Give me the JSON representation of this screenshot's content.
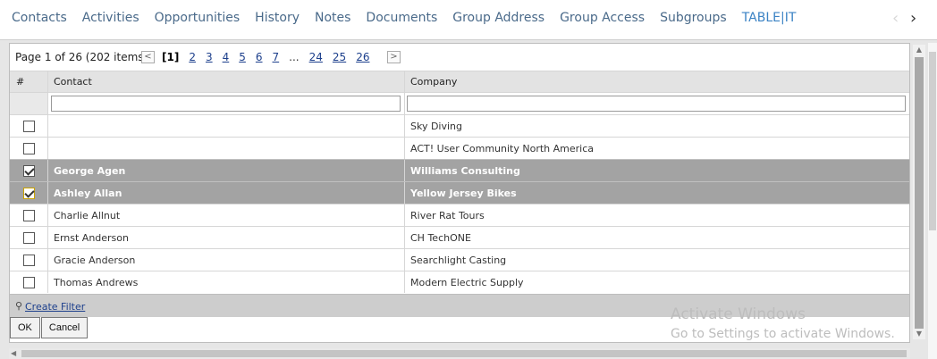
{
  "tabs": [
    {
      "label": "Contacts"
    },
    {
      "label": "Activities"
    },
    {
      "label": "Opportunities"
    },
    {
      "label": "History"
    },
    {
      "label": "Notes"
    },
    {
      "label": "Documents"
    },
    {
      "label": "Group Address"
    },
    {
      "label": "Group Access"
    },
    {
      "label": "Subgroups"
    },
    {
      "label": "TABLE|IT"
    }
  ],
  "tab_nav": {
    "prev": "‹",
    "next": "›"
  },
  "pager": {
    "info": "Page 1 of 26 (202 items)",
    "prev": "<",
    "next": ">",
    "pages": [
      "[1]",
      "2",
      "3",
      "4",
      "5",
      "6",
      "7",
      "...",
      "24",
      "25",
      "26"
    ]
  },
  "grid": {
    "columns": [
      "#",
      "Contact",
      "Company"
    ],
    "rows": [
      {
        "contact": "",
        "company": "Sky Diving",
        "checked": false
      },
      {
        "contact": "",
        "company": "ACT! User Community North America",
        "checked": false
      },
      {
        "contact": "George Agen",
        "company": "Williams Consulting",
        "checked": true
      },
      {
        "contact": "Ashley Allan",
        "company": "Yellow Jersey Bikes",
        "checked": true
      },
      {
        "contact": "Charlie Allnut",
        "company": "River Rat Tours",
        "checked": false
      },
      {
        "contact": "Ernst Anderson",
        "company": "CH TechONE",
        "checked": false
      },
      {
        "contact": "Gracie Anderson",
        "company": "Searchlight Casting",
        "checked": false
      },
      {
        "contact": "Thomas Andrews",
        "company": "Modern Electric Supply",
        "checked": false
      }
    ]
  },
  "footer": {
    "create_filter": "Create Filter",
    "filter_icon": "filter-icon"
  },
  "buttons": {
    "ok": "OK",
    "cancel": "Cancel"
  },
  "watermark": {
    "line1": "Activate Windows",
    "line2": "Go to Settings to activate Windows."
  },
  "colors": {
    "tab_text": "#4a6a8a",
    "tab_active": "#3a82c4",
    "selected_row": "#a3a3a3",
    "link": "#1c3f8c"
  }
}
